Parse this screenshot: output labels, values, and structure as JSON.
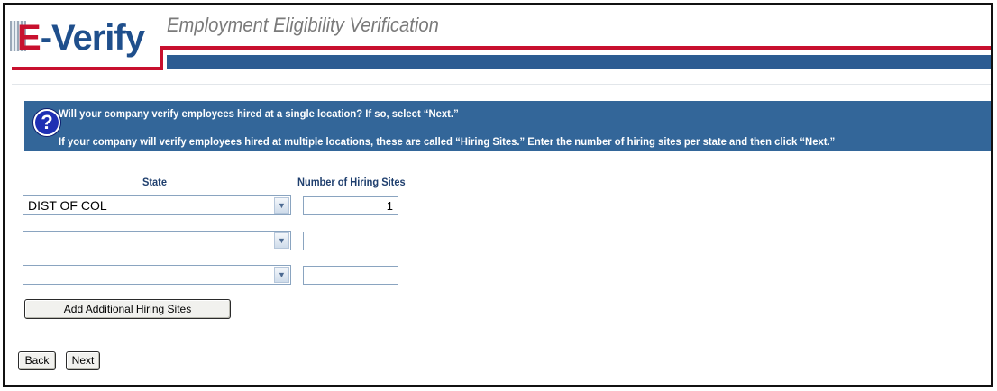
{
  "header": {
    "logo_e": "E",
    "logo_rest": "-Verify",
    "title": "Employment Eligibility Verification"
  },
  "banner": {
    "icon": "question-mark-icon",
    "line1": "Will your company verify employees hired at a single location? If so, select “Next.”",
    "line2": "If your company will verify employees hired at multiple locations, these are called “Hiring Sites.” Enter the number of hiring sites per state and then click “Next.”"
  },
  "form": {
    "state_header": "State",
    "sites_header": "Number of Hiring Sites",
    "rows": [
      {
        "state": "DIST OF COL",
        "sites": "1"
      },
      {
        "state": "",
        "sites": ""
      },
      {
        "state": "",
        "sites": ""
      }
    ],
    "add_button": "Add Additional Hiring Sites"
  },
  "nav": {
    "back_label": "Back",
    "next_label": "Next"
  },
  "colors": {
    "brand_red": "#c8102e",
    "brand_blue": "#2c5c92",
    "banner_blue": "#336699"
  }
}
